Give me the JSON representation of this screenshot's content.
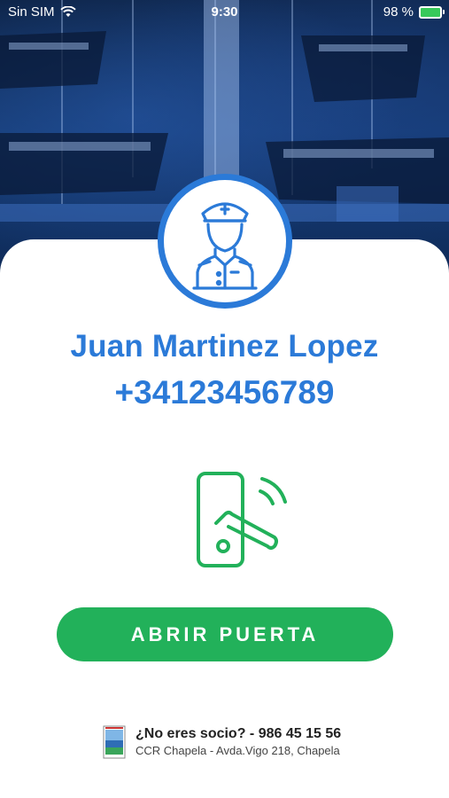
{
  "status_bar": {
    "carrier": "Sin SIM",
    "time": "9:30",
    "battery": "98 %",
    "battery_level": 0.98,
    "wifi_icon": "wifi-icon",
    "battery_icon": "battery-charging-icon"
  },
  "profile": {
    "avatar_icon": "ship-captain-icon",
    "name": "Juan Martinez Lopez",
    "phone": "+34123456789"
  },
  "door": {
    "icon": "smart-lock-icon",
    "button_label": "ABRIR PUERTA"
  },
  "footer": {
    "logo": "club-logo",
    "title": "¿No eres socio? - 986 45 15 56",
    "address": "CCR Chapela - Avda.Vigo 218, Chapela"
  },
  "colors": {
    "primary_blue": "#2b7ad8",
    "button_green": "#22b15a",
    "lock_green": "#22b15a"
  }
}
